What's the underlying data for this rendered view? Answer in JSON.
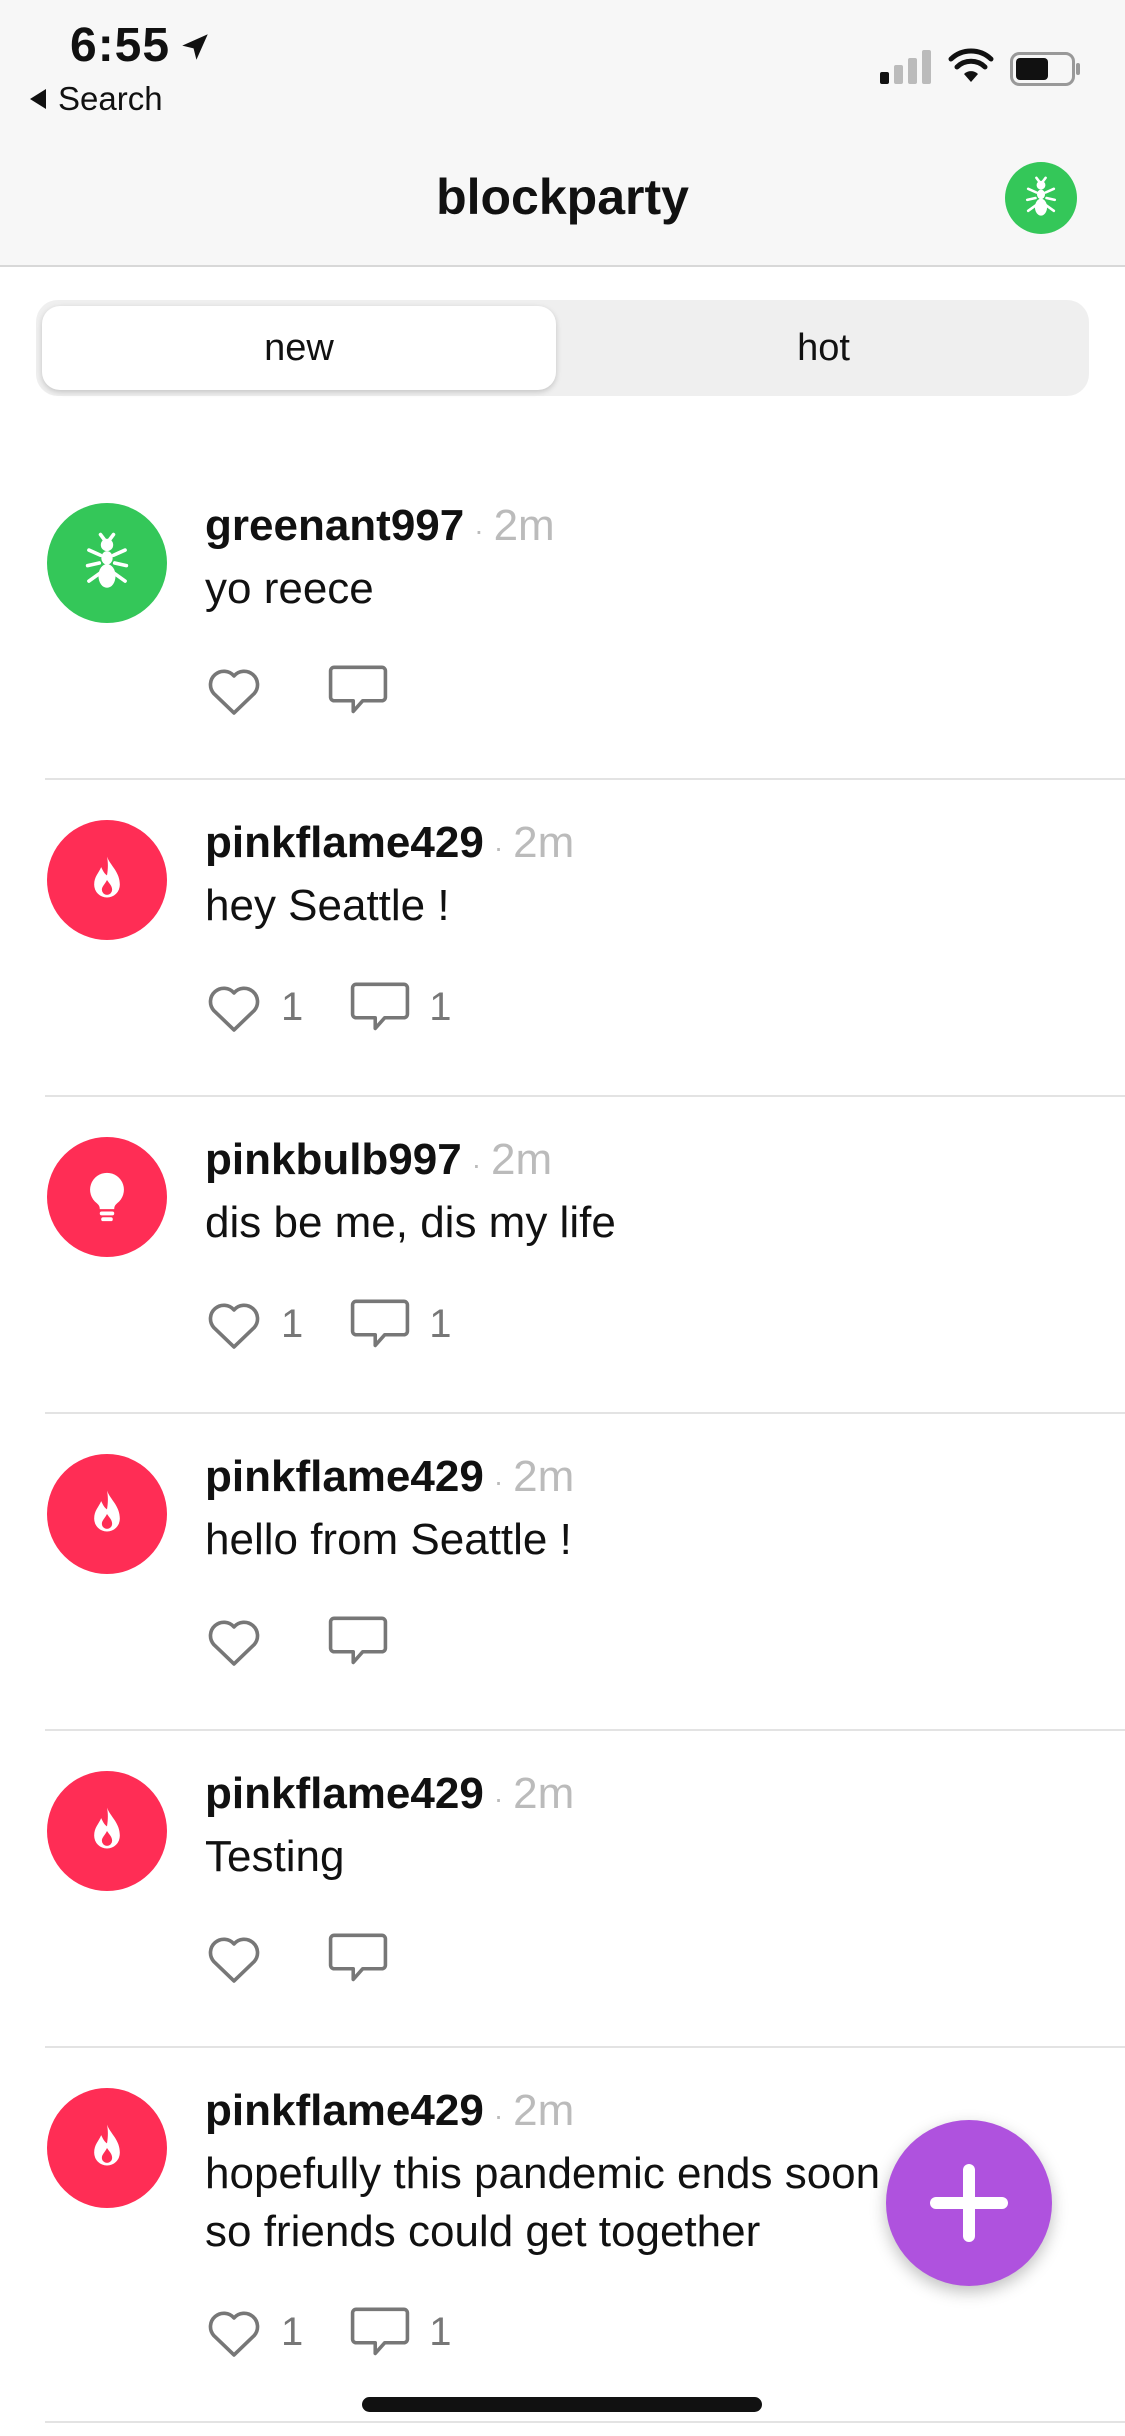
{
  "status_bar": {
    "time": "6:55",
    "back_label": "Search"
  },
  "nav": {
    "title": "blockparty"
  },
  "tabs": [
    {
      "label": "new"
    },
    {
      "label": "hot"
    }
  ],
  "colors": {
    "green": "#34c759",
    "pink": "#ff2d55",
    "fab": "#af52de"
  },
  "posts": [
    {
      "user": "greenant997",
      "time": "2m",
      "text": "yo reece",
      "avatar_icon": "ant-icon",
      "avatar_color": "green",
      "likes": "",
      "comments": ""
    },
    {
      "user": "pinkflame429",
      "time": "2m",
      "text": "hey Seattle !",
      "avatar_icon": "flame-icon",
      "avatar_color": "pink",
      "likes": "1",
      "comments": "1"
    },
    {
      "user": "pinkbulb997",
      "time": "2m",
      "text": "dis be me, dis my life",
      "avatar_icon": "bulb-icon",
      "avatar_color": "pink",
      "likes": "1",
      "comments": "1"
    },
    {
      "user": "pinkflame429",
      "time": "2m",
      "text": "hello from Seattle !",
      "avatar_icon": "flame-icon",
      "avatar_color": "pink",
      "likes": "",
      "comments": ""
    },
    {
      "user": "pinkflame429",
      "time": "2m",
      "text": "Testing",
      "avatar_icon": "flame-icon",
      "avatar_color": "pink",
      "likes": "",
      "comments": ""
    },
    {
      "user": "pinkflame429",
      "time": "2m",
      "text": "hopefully this pandemic ends soon so friends could get together",
      "avatar_icon": "flame-icon",
      "avatar_color": "pink",
      "likes": "1",
      "comments": "1"
    }
  ],
  "fab": {
    "icon": "plus-icon"
  }
}
